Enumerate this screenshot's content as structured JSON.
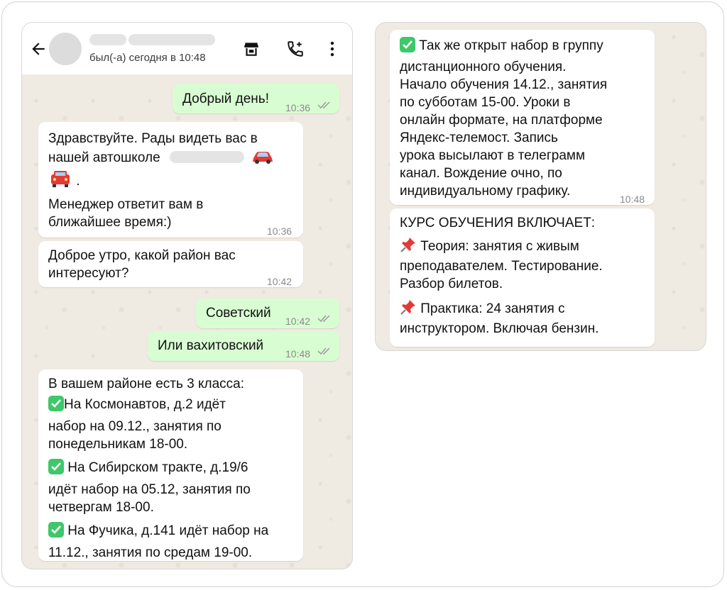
{
  "header": {
    "status": "был(-а) сегодня в 10:48"
  },
  "colors": {
    "incoming_bubble": "#ffffff",
    "outgoing_bubble": "#d9fdd3",
    "chat_background": "#efeae2",
    "check_emoji": "#3ec76b",
    "pin_emoji": "#e53935"
  },
  "icons": [
    "back-arrow-icon",
    "store-icon",
    "call-add-icon",
    "more-vert-icon",
    "double-check-icon",
    "check-mark-emoji-icon",
    "pushpin-emoji-icon",
    "car-emoji-icon"
  ],
  "messages": {
    "m1": {
      "text": "Добрый день!",
      "time": "10:36"
    },
    "m2": {
      "l1": "Здравствуйте. Рады видеть вас в",
      "l2": "нашей автошколе",
      "l3": ".",
      "l4": "Менеджер ответит вам в",
      "l5": "ближайшее время:)",
      "time": "10:36"
    },
    "m3": {
      "l1": "Доброе утро, какой район вас",
      "l2": "интересуют?",
      "time": "10:42"
    },
    "m4": {
      "text": "Советский",
      "time": "10:42"
    },
    "m5": {
      "text": "Или вахитовский",
      "time": "10:48"
    },
    "m6": {
      "l1": "В вашем районе есть 3 класса:",
      "l2": "На Космонавтов, д.2 идёт",
      "l3": "набор на 09.12., занятия по",
      "l4": "понедельникам 18-00.",
      "l5": " На Сибирском тракте, д.19/6",
      "l6": "идёт набор на 05.12, занятия по",
      "l7": "четвергам 18-00.",
      "l8": " На Фучика, д.141 идёт набор на",
      "l9": "11.12., занятия по средам 19-00."
    },
    "m7": {
      "l1": " Так же открыт набор в группу",
      "l2": "дистанционного обучения.",
      "l3": "Начало обучения 14.12., занятия",
      "l4": "по субботам 15-00.  Уроки в",
      "l5": "онлайн формате, на платформе",
      "l6": "Яндекс-телемост. Запись",
      "l7": "урока высылают в телеграмм",
      "l8": "канал. Вождение очно, по",
      "l9": "индивидуальному графику.",
      "time": "10:48"
    },
    "m8": {
      "l1": "КУРС ОБУЧЕНИЯ ВКЛЮЧАЕТ:",
      "l2": " Теория: занятия с живым",
      "l3": "преподавателем. Тестирование.",
      "l4": "Разбор билетов.",
      "l5": " Практика: 24 занятия с",
      "l6": "инструктором. Включая бензин."
    }
  }
}
